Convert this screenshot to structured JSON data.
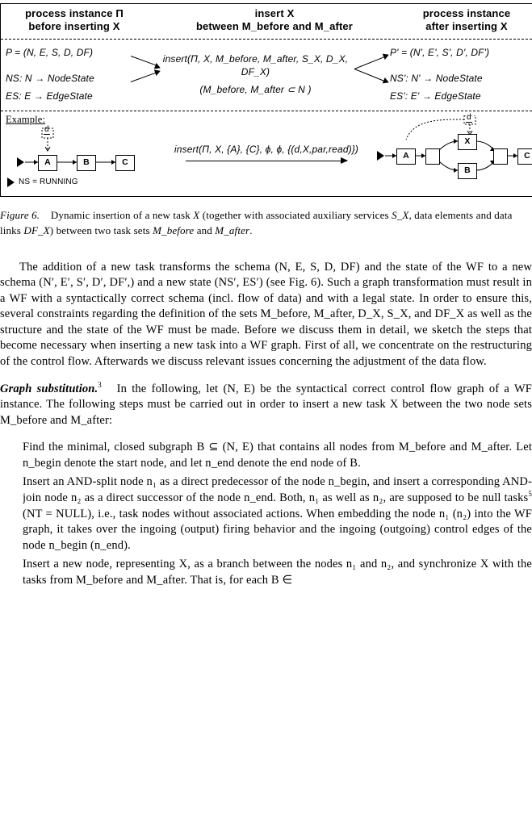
{
  "diagram": {
    "headers": {
      "left_l1": "process instance Π",
      "left_l2": "before inserting X",
      "mid_l1": "insert X",
      "mid_l2": "between M_before and M_after",
      "right_l1": "process instance",
      "right_l2": "after inserting X"
    },
    "mid_left": {
      "p_def": "P = (N, E, S, D, DF)",
      "ns_map": "NS: N → NodeState",
      "es_map": "ES: E → EdgeState"
    },
    "mid_center": {
      "insert_call": "insert(Π, X, M_before, M_after, S_X, D_X, DF_X)",
      "subset": "(M_before, M_after  ⊂ N )"
    },
    "mid_right": {
      "pprime": "P' = (N', E', S', D', DF')",
      "nsprime_map": "NS': N' → NodeState",
      "esprime_map": "ES': E' → EdgeState"
    },
    "example": {
      "label": "Example:",
      "d_var": "d",
      "nodeA": "A",
      "nodeB": "B",
      "nodeC": "C",
      "nodeX": "X",
      "run_state": "NS = RUNNING",
      "insert_ex": "insert(Π, X, {A}, {C}, ϕ, ϕ, {(d,X,par,read)})"
    }
  },
  "caption": {
    "fignum": "Figure 6.",
    "text_a": "Dynamic insertion of a new task ",
    "xvar": "X",
    "text_b": " (together with associated auxiliary services ",
    "sx": "S_X",
    "text_c": ", data elements ",
    "dx_links": "DF_X",
    "text_d": ") between two task sets ",
    "mbef": "M_before",
    "and": " and ",
    "maft": "M_after",
    "period": "."
  },
  "body": {
    "p1": "The addition of a new task transforms the schema (N, E, S, D, DF) and the state of the WF to a new schema (N′, E′, S′, D′, DF′,) and a new state (NS′, ES′) (see Fig. 6).  Such a graph transformation must result in a WF with a syntactically correct schema (incl. flow of data) and with a legal state. In order to ensure this, several constraints regarding the definition of the sets M_before, M_after, D_X, S_X, and DF_X as well as the structure and the state of the WF must be made. Before we discuss them in detail, we sketch the steps that become necessary when inserting a new task into a WF graph. First of all, we concentrate on the restructuring of the control flow. Afterwards we discuss relevant issues concerning the adjustment of the data flow.",
    "p2_lead": "Graph substitution.",
    "p2_fn": "3",
    "p2_body": "In the following, let (N, E) be the syntactical correct control flow graph of a WF instance. The following steps must be carried out in order to insert a new task X between the two node sets M_before and M_after:",
    "li1": "Find the minimal, closed subgraph B ⊆ (N, E) that contains all nodes from M_before and M_after. Let n_begin denote the start node, and let n_end denote the end node of B.",
    "li2_a": "Insert an AND-split node n₁ as a direct predecessor of the node n_begin, and insert a corresponding AND-join node n₂ as a direct successor of the node n_end. Both, n₁ as well as n₂, are supposed to be null tasks",
    "li2_fn": "5",
    "li2_b": " (NT = NULL), i.e., task nodes without associated actions. When embedding the node n₁ (n₂) into the WF graph, it takes over the ingoing (output) firing behavior and the ingoing (outgoing) control edges of the node n_begin (n_end).",
    "li3": "Insert a new node, representing X, as a branch between the nodes n₁ and n₂, and synchronize X with the tasks from M_before and M_after. That is, for each B ∈"
  }
}
